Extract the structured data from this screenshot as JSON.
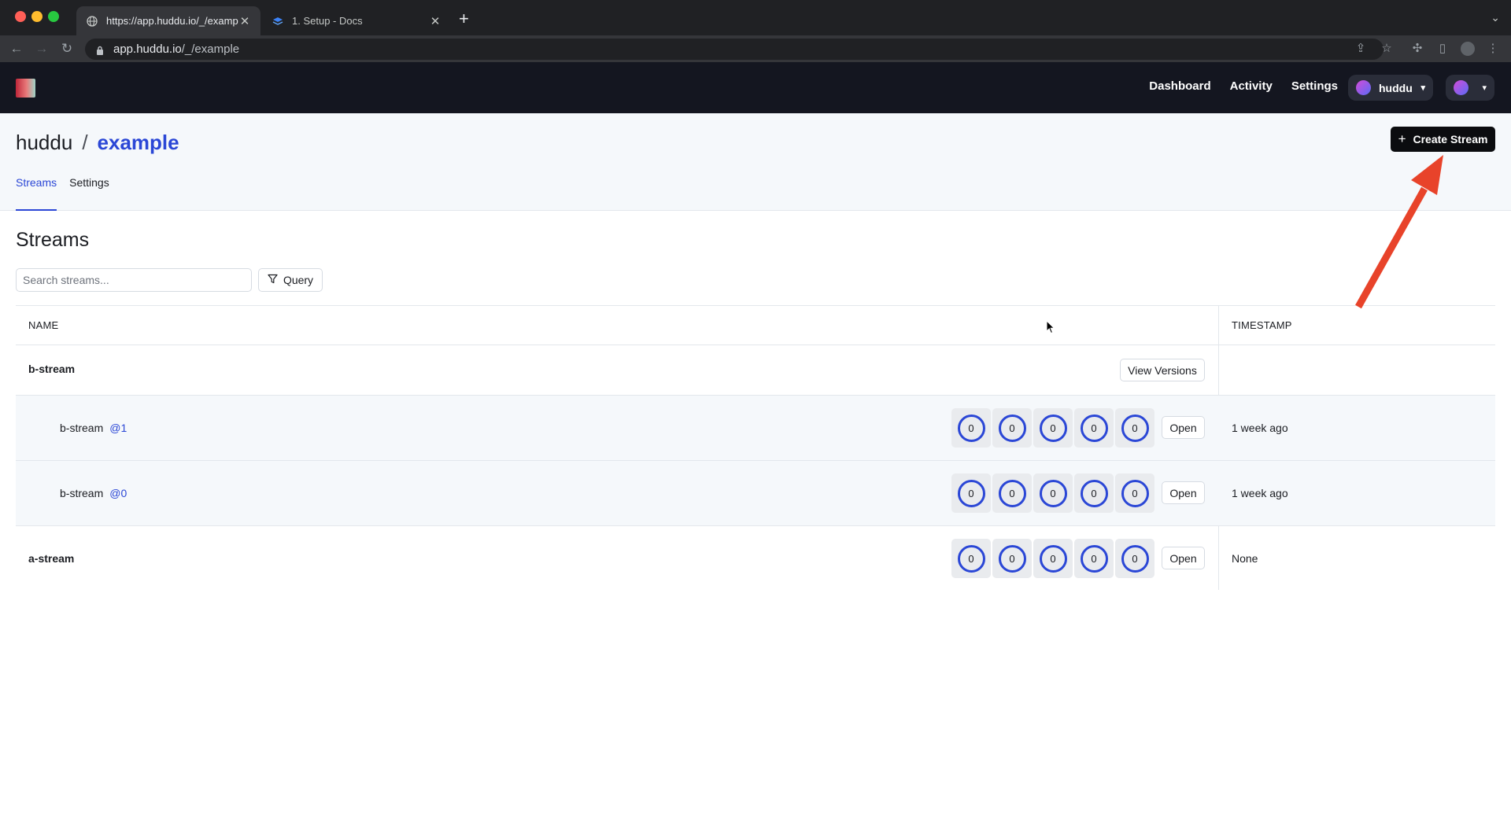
{
  "browser": {
    "tabs": [
      {
        "title": "https://app.huddu.io/_/example",
        "icon": "globe-icon",
        "active": true
      },
      {
        "title": "1. Setup - Docs",
        "icon": "docs-stack-icon",
        "active": false
      }
    ],
    "url_host": "app.huddu.io",
    "url_path": "/_/example"
  },
  "nav": {
    "links": [
      "Dashboard",
      "Activity",
      "Settings"
    ],
    "org_name": "huddu"
  },
  "header": {
    "org": "huddu",
    "separator": "/",
    "project": "example",
    "create_button": "Create Stream",
    "tabs": [
      "Streams",
      "Settings"
    ],
    "active_tab": "Streams"
  },
  "streams": {
    "title": "Streams",
    "search_placeholder": "Search streams...",
    "query_label": "Query",
    "columns": {
      "name": "NAME",
      "timestamp": "TIMESTAMP"
    },
    "rows": [
      {
        "name": "b-stream",
        "version": "",
        "action": "View Versions",
        "timestamp": ""
      },
      {
        "name": "b-stream",
        "version": "@1",
        "stats": [
          "0",
          "0",
          "0",
          "0",
          "0"
        ],
        "action": "Open",
        "timestamp": "1 week ago"
      },
      {
        "name": "b-stream",
        "version": "@0",
        "stats": [
          "0",
          "0",
          "0",
          "0",
          "0"
        ],
        "action": "Open",
        "timestamp": "1 week ago"
      },
      {
        "name": "a-stream",
        "version": "",
        "stats": [
          "0",
          "0",
          "0",
          "0",
          "0"
        ],
        "action": "Open",
        "timestamp": "None"
      }
    ]
  },
  "colors": {
    "accent": "#2b47d6",
    "nav_bg": "#141620",
    "annotation_arrow": "#e8432a"
  }
}
